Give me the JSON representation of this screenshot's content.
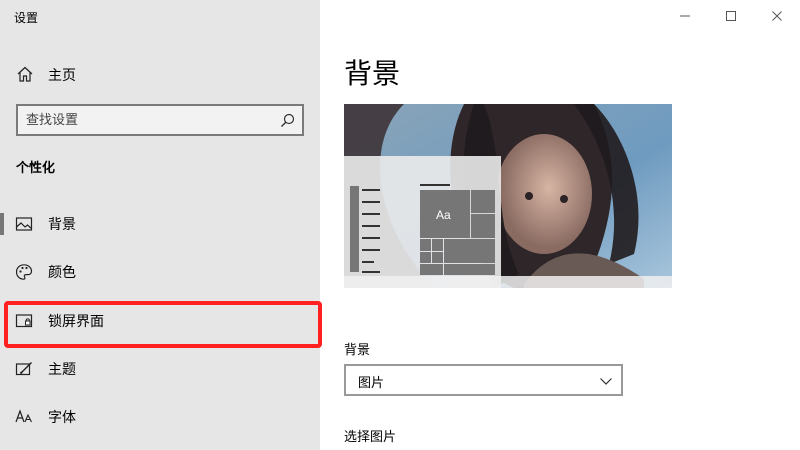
{
  "window": {
    "title": "设置"
  },
  "sidebar": {
    "home_label": "主页",
    "search_placeholder": "查找设置",
    "section_title": "个性化",
    "items": [
      {
        "label": "背景",
        "icon": "image-icon",
        "selected": true
      },
      {
        "label": "颜色",
        "icon": "palette-icon",
        "selected": false
      },
      {
        "label": "锁屏界面",
        "icon": "lock-screen-icon",
        "selected": false
      },
      {
        "label": "主题",
        "icon": "theme-icon",
        "selected": false
      },
      {
        "label": "字体",
        "icon": "font-icon",
        "selected": false
      }
    ]
  },
  "main": {
    "page_title": "背景",
    "preview": {
      "tile_text": "Aa"
    },
    "background_label": "背景",
    "background_select_value": "图片",
    "choose_picture_label": "选择图片"
  },
  "colors": {
    "sidebar_bg": "#e6e6e6",
    "highlight": "#ff2020",
    "tile": "#767676"
  }
}
